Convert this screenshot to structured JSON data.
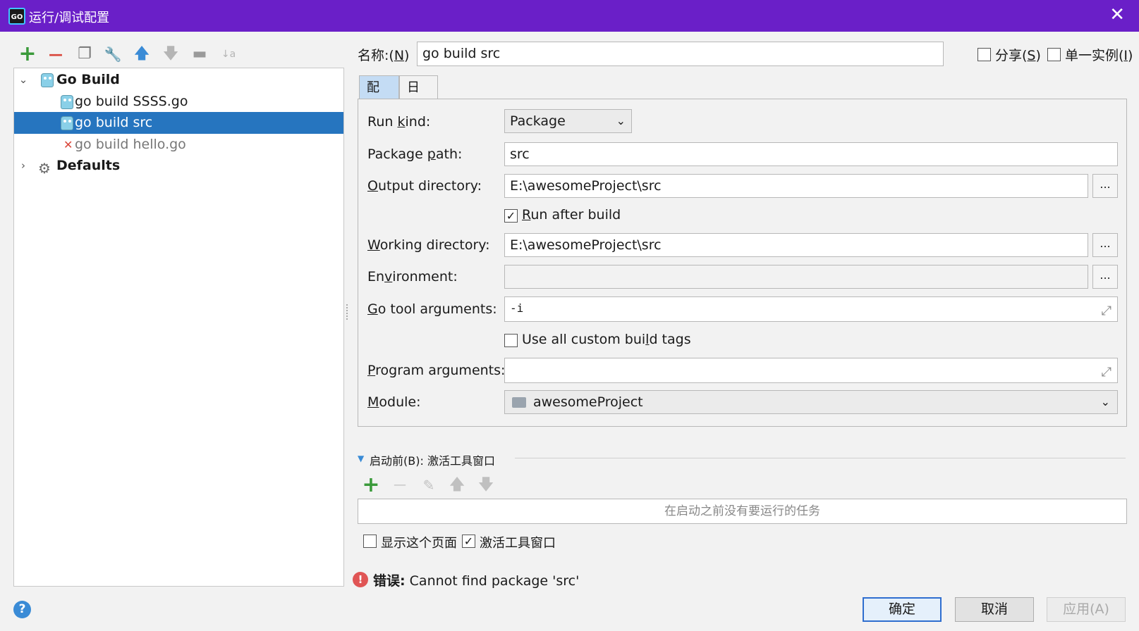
{
  "window": {
    "app_icon_text": "GO",
    "title": "运行/调试配置",
    "close_glyph": "✕"
  },
  "toolbar": {
    "add": "+",
    "remove": "—",
    "copy": "❐",
    "edit_defaults": "🔧",
    "move_up": "🡅",
    "move_down": "🡇",
    "folder": "▬",
    "sort": "↓a z"
  },
  "tree": {
    "group": {
      "label": "Go Build",
      "expanded": true
    },
    "items": [
      {
        "label": "go build SSSS.go",
        "selected": false,
        "temporary": false
      },
      {
        "label": "go build src",
        "selected": true,
        "temporary": false
      },
      {
        "label": "go build hello.go",
        "selected": false,
        "temporary": true
      }
    ],
    "defaults": {
      "label": "Defaults",
      "expanded": false
    }
  },
  "header": {
    "name_label": "名称:(",
    "name_mnemonic": "N",
    "name_label_end": ")",
    "name_value": "go build src",
    "share_label": "分享(",
    "share_mnemonic": "S",
    "share_label_end": ")",
    "share_checked": false,
    "single_label": "单一实例(",
    "single_mnemonic": "I",
    "single_label_end": ")",
    "single_checked": false
  },
  "tabs": [
    {
      "label": "配置",
      "active": true
    },
    {
      "label": "日志",
      "active": false
    }
  ],
  "config": {
    "run_kind_label": "Run kind:",
    "run_kind_value": "Package",
    "package_path_label": "Package path:",
    "package_path_value": "src",
    "output_dir_label": "Output directory:",
    "output_dir_value": "E:\\awesomeProject\\src",
    "run_after_build_label": "Run after build",
    "run_after_build_checked": true,
    "working_dir_label": "Working directory:",
    "working_dir_value": "E:\\awesomeProject\\src",
    "environment_label": "Environment:",
    "environment_value": "",
    "go_tool_args_label": "Go tool arguments:",
    "go_tool_args_value": "-i",
    "custom_tags_label": "Use all custom build tags",
    "custom_tags_checked": false,
    "program_args_label": "Program arguments:",
    "program_args_value": "",
    "module_label": "Module:",
    "module_value": "awesomeProject",
    "browse": "..."
  },
  "before_launch": {
    "title": "启动前(B): 激活工具窗口",
    "empty_text": "在启动之前没有要运行的任务",
    "show_page_label": "显示这个页面",
    "show_page_checked": false,
    "activate_label": "激活工具窗口",
    "activate_checked": true
  },
  "error": {
    "prefix": "错误:",
    "message": "Cannot find package 'src'"
  },
  "buttons": {
    "help": "?",
    "ok": "确定",
    "cancel": "取消",
    "apply": "应用(A)"
  },
  "colors": {
    "titlebar": "#6a1fc8",
    "selection": "#2675bf",
    "add_green": "#3a9a3a",
    "remove_red": "#d9463a",
    "arrow_blue": "#3a8bd6",
    "error_red": "#e05555"
  }
}
